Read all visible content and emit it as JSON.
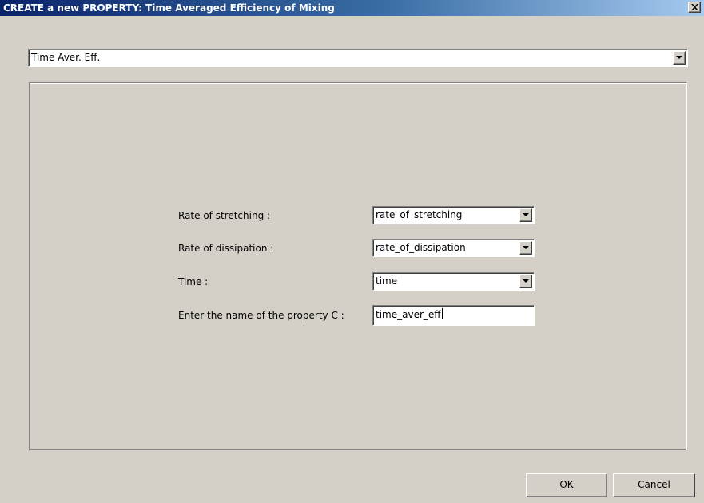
{
  "window": {
    "title": "CREATE a new PROPERTY: Time Averaged Efficiency of Mixing"
  },
  "property_type": {
    "selected": "Time Aver. Eff."
  },
  "form": {
    "fields": [
      {
        "label": "Rate of stretching :",
        "value": "rate_of_stretching"
      },
      {
        "label": "Rate of dissipation :",
        "value": "rate_of_dissipation"
      },
      {
        "label": "Time :",
        "value": "time"
      }
    ],
    "name_field": {
      "label": "Enter the name of the property C :",
      "value": "time_aver_eff"
    }
  },
  "buttons": {
    "ok_accel": "O",
    "ok_rest": "K",
    "cancel_accel": "C",
    "cancel_rest": "ancel"
  },
  "icons": {
    "close": "close-icon",
    "dropdown": "chevron-down-icon"
  },
  "colors": {
    "title_start": "#0a246a",
    "title_end": "#a6caf0",
    "face": "#d4d0c8"
  }
}
